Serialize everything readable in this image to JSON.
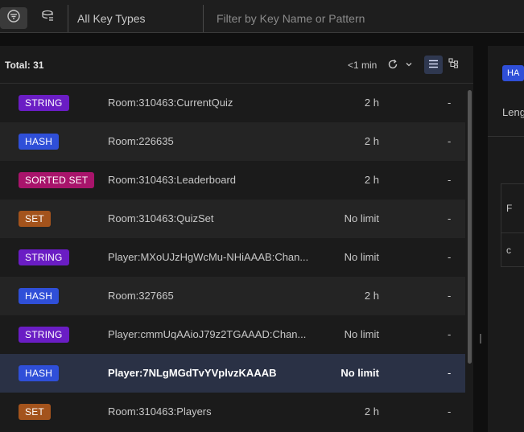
{
  "filter_bar": {
    "filter_icon": "filter-icon",
    "tree_icon": "key-tree-icon",
    "type_select_value": "All Key Types",
    "search_placeholder": "Filter by Key Name or Pattern"
  },
  "list_header": {
    "total_label": "Total: 31",
    "refresh_time": "<1 min",
    "refresh_icon": "refresh-icon",
    "dropdown_icon": "chevron-down-icon",
    "list_view_icon": "list-view-icon",
    "tree_view_icon": "tree-view-icon"
  },
  "type_colors": {
    "STRING": "#6a1dc4",
    "HASH": "#2f4fd8",
    "SORTED SET": "#a8146b",
    "SET": "#a3531c"
  },
  "keys": [
    {
      "type": "STRING",
      "name": "Room:310463:CurrentQuiz",
      "ttl": "2 h",
      "size": "-"
    },
    {
      "type": "HASH",
      "name": "Room:226635",
      "ttl": "2 h",
      "size": "-"
    },
    {
      "type": "SORTED SET",
      "name": "Room:310463:Leaderboard",
      "ttl": "2 h",
      "size": "-"
    },
    {
      "type": "SET",
      "name": "Room:310463:QuizSet",
      "ttl": "No limit",
      "size": "-"
    },
    {
      "type": "STRING",
      "name": "Player:MXoUJzHgWcMu-NHiAAAB:Chan...",
      "ttl": "No limit",
      "size": "-"
    },
    {
      "type": "HASH",
      "name": "Room:327665",
      "ttl": "2 h",
      "size": "-"
    },
    {
      "type": "STRING",
      "name": "Player:cmmUqAAioJ79z2TGAAAD:Chan...",
      "ttl": "No limit",
      "size": "-"
    },
    {
      "type": "HASH",
      "name": "Player:7NLgMGdTvYVplvzKAAAB",
      "ttl": "No limit",
      "size": "-"
    },
    {
      "type": "SET",
      "name": "Room:310463:Players",
      "ttl": "2 h",
      "size": "-"
    }
  ],
  "selected_index": 7,
  "details": {
    "type_badge": "HA",
    "length_label": "Leng",
    "col1": "F",
    "col2": "c"
  }
}
